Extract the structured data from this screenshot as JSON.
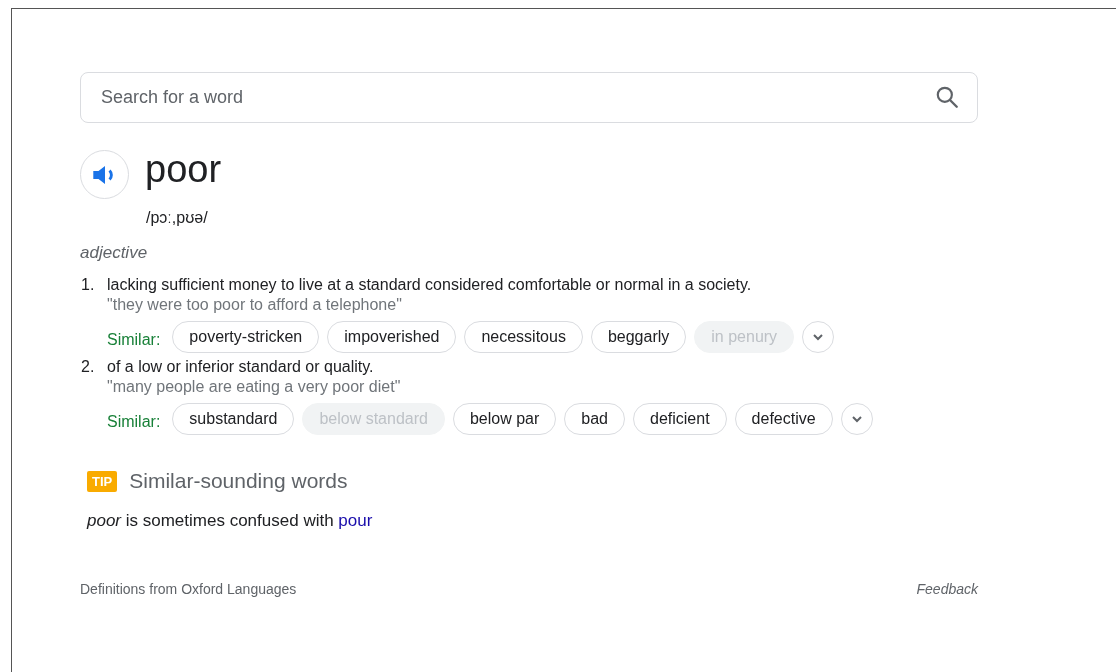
{
  "search": {
    "placeholder": "Search for a word"
  },
  "entry": {
    "word": "poor",
    "phonetic": "/pɔː,pʊə/",
    "part_of_speech": "adjective"
  },
  "senses": [
    {
      "number": "1.",
      "definition": "lacking sufficient money to live at a standard considered comfortable or normal in a society.",
      "example": "\"they were too poor to afford a telephone\"",
      "similar_label": "Similar:",
      "similar": [
        {
          "word": "poverty-stricken",
          "disabled": false
        },
        {
          "word": "impoverished",
          "disabled": false
        },
        {
          "word": "necessitous",
          "disabled": false
        },
        {
          "word": "beggarly",
          "disabled": false
        },
        {
          "word": "in penury",
          "disabled": true
        }
      ]
    },
    {
      "number": "2.",
      "definition": "of a low or inferior standard or quality.",
      "example": "\"many people are eating a very poor diet\"",
      "similar_label": "Similar:",
      "similar": [
        {
          "word": "substandard",
          "disabled": false
        },
        {
          "word": "below standard",
          "disabled": true
        },
        {
          "word": "below par",
          "disabled": false
        },
        {
          "word": "bad",
          "disabled": false
        },
        {
          "word": "deficient",
          "disabled": false
        },
        {
          "word": "defective",
          "disabled": false
        }
      ]
    }
  ],
  "tip": {
    "badge": "TIP",
    "title": "Similar-sounding words",
    "sentence": "*poor* is sometimes confused with",
    "link": "pour"
  },
  "footer": {
    "source": "Definitions from Oxford Languages",
    "feedback": "Feedback"
  }
}
